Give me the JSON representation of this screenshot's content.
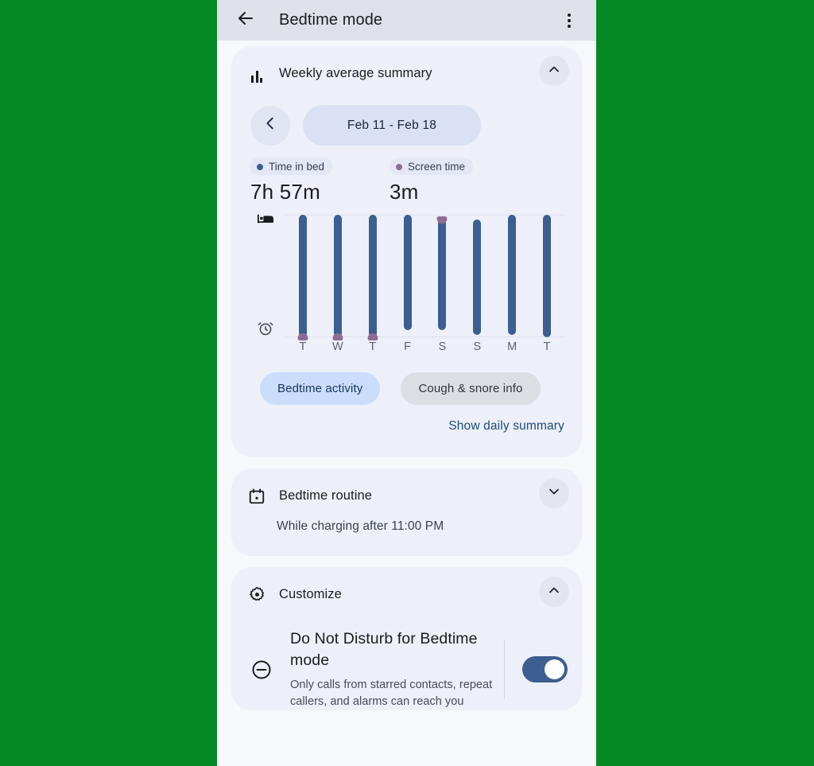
{
  "theme": {
    "page_background": "#048A24",
    "phone_background": "#F7F8FC",
    "appbar_background": "#DEE1E8",
    "card_background": "#EDF0F8",
    "accent_blue": "#3C5E91",
    "accent_purple": "#8D6E92",
    "chip_primary": "#CBDDFB",
    "chip_secondary": "#DCDEE3",
    "link_color": "#1F4A7C",
    "toggle_on": "#3C5E91"
  },
  "appbar": {
    "back_icon": "arrow-back-icon",
    "title": "Bedtime mode",
    "overflow_icon": "more-vert-icon"
  },
  "weekly_summary": {
    "icon": "bar-chart-icon",
    "title": "Weekly average summary",
    "expand_state": "expanded",
    "chevron_icon": "chevron-up-icon",
    "prev_week_icon": "chevron-left-icon",
    "date_range": "Feb 11 - Feb 18",
    "stats": [
      {
        "label": "Time in bed",
        "value": "7h 57m",
        "dot_color": "#3C5E91"
      },
      {
        "label": "Screen time",
        "value": "3m",
        "dot_color": "#8D6E92"
      }
    ],
    "axis_icons": {
      "top": "bed-icon",
      "bottom": "alarm-clock-icon"
    },
    "chips": [
      {
        "label": "Bedtime activity",
        "style": "primary"
      },
      {
        "label": "Cough & snore info",
        "style": "secondary"
      }
    ],
    "show_daily_summary": "Show daily summary"
  },
  "chart_data": {
    "type": "bar",
    "title": "Weekly average summary",
    "xlabel": "",
    "ylabel": "",
    "grid": true,
    "legend_position": "top",
    "categories": [
      "T",
      "W",
      "T",
      "F",
      "S",
      "S",
      "M",
      "T"
    ],
    "series": [
      {
        "name": "Time in bed",
        "color": "#3C5E91",
        "unit": "fraction of plot height (0 = wake/alarm line, 1 = bedtime line)",
        "bar_top": [
          1.0,
          1.0,
          1.0,
          1.0,
          0.96,
          0.96,
          1.0,
          1.0
        ],
        "bar_bottom": [
          0.0,
          0.0,
          0.0,
          0.06,
          0.06,
          0.02,
          0.02,
          0.0
        ]
      },
      {
        "name": "Screen time",
        "color": "#8D6E92",
        "markers": [
          {
            "category_index": 0,
            "position": "bottom"
          },
          {
            "category_index": 1,
            "position": "bottom"
          },
          {
            "category_index": 2,
            "position": "bottom"
          },
          {
            "category_index": 4,
            "position": "top"
          }
        ]
      }
    ]
  },
  "bedtime_routine": {
    "icon": "calendar-icon",
    "title": "Bedtime routine",
    "expand_state": "collapsed",
    "chevron_icon": "chevron-down-icon",
    "subtitle": "While charging after 11:00 PM"
  },
  "customize": {
    "icon": "gear-icon",
    "title": "Customize",
    "expand_state": "expanded",
    "chevron_icon": "chevron-up-icon",
    "items": [
      {
        "icon": "do-not-disturb-icon",
        "title": "Do Not Disturb for Bedtime mode",
        "description": "Only calls from starred contacts, repeat callers, and alarms can reach you",
        "toggle_state": "on"
      }
    ]
  }
}
